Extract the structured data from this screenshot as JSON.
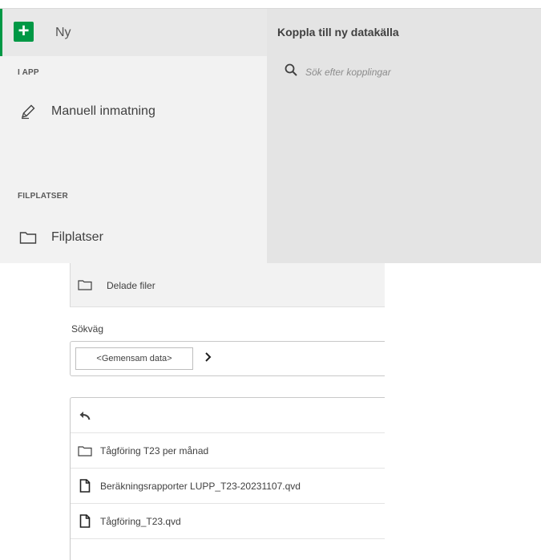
{
  "sidebar": {
    "new_label": "Ny",
    "sections": [
      {
        "heading": "I APP",
        "items": [
          {
            "label": "Manuell inmatning",
            "icon": "pencil-icon"
          }
        ]
      },
      {
        "heading": "FILPLATSER",
        "items": [
          {
            "label": "Filplatser",
            "icon": "folder-icon"
          }
        ]
      }
    ]
  },
  "main": {
    "title": "Koppla till ny datakälla",
    "search_placeholder": "Sök efter kopplingar"
  },
  "browser": {
    "shared_files": "Delade filer",
    "path_label": "Sökväg",
    "breadcrumb": "<Gemensam data>",
    "items": [
      {
        "type": "folder",
        "name": "Tågföring T23 per månad"
      },
      {
        "type": "file",
        "name": "Beräkningsrapporter LUPP_T23-20231107.qvd"
      },
      {
        "type": "file",
        "name": "Tågföring_T23.qvd"
      }
    ]
  },
  "colors": {
    "accent": "#009845",
    "sidebar_bg": "#f2f2f2",
    "content_bg": "#e4e4e4"
  }
}
